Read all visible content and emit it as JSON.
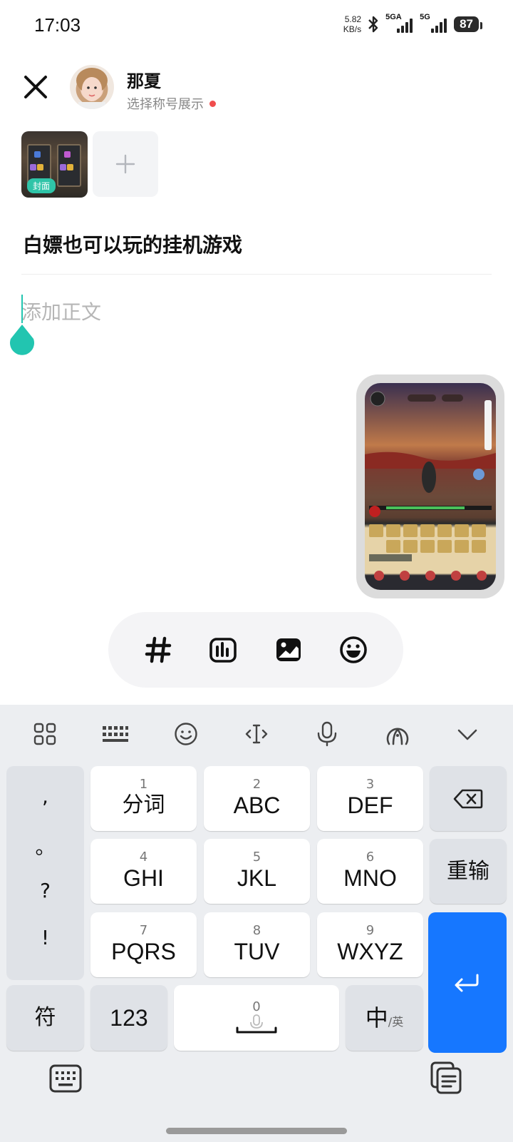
{
  "status_bar": {
    "time": "17:03",
    "net_speed_value": "5.82",
    "net_speed_unit": "KB/s",
    "signal1_label": "5GA",
    "signal2_label": "5G",
    "battery": "87"
  },
  "header": {
    "user_name": "那夏",
    "title_prompt": "选择称号展示"
  },
  "media": {
    "cover_badge": "封面"
  },
  "editor": {
    "post_title": "白嫖也可以玩的挂机游戏",
    "body_placeholder": "添加正文"
  },
  "toolbar": {
    "icons": [
      "hashtag-icon",
      "chart-card-icon",
      "image-icon",
      "emoji-icon"
    ]
  },
  "keyboard": {
    "top_bar_icons": [
      "apps-grid-icon",
      "keyboard-layout-icon",
      "emoji-icon",
      "cursor-move-icon",
      "microphone-icon",
      "handwriting-icon",
      "collapse-keyboard-icon"
    ],
    "punctuation": [
      ",",
      "。",
      "?",
      "!"
    ],
    "keys": [
      {
        "num": "1",
        "label": "分词"
      },
      {
        "num": "2",
        "label": "ABC"
      },
      {
        "num": "3",
        "label": "DEF"
      },
      {
        "num": "4",
        "label": "GHI"
      },
      {
        "num": "5",
        "label": "JKL"
      },
      {
        "num": "6",
        "label": "MNO"
      },
      {
        "num": "7",
        "label": "PQRS"
      },
      {
        "num": "8",
        "label": "TUV"
      },
      {
        "num": "9",
        "label": "WXYZ"
      }
    ],
    "reinput": "重输",
    "symbols": "符",
    "numbers": "123",
    "space_num": "0",
    "lang_main": "中",
    "lang_sub": "/英"
  }
}
